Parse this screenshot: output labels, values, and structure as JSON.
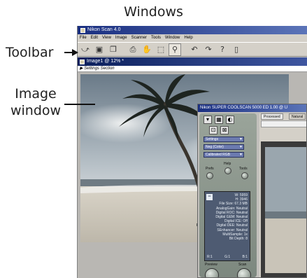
{
  "captions": {
    "windows": "Windows",
    "toolbar": "Toolbar",
    "image_window_line1": "Image",
    "image_window_line2": "window"
  },
  "app": {
    "title": "Nikon Scan 4.0",
    "menu": [
      "File",
      "Edit",
      "View",
      "Image",
      "Scanner",
      "Tools",
      "Window",
      "Help"
    ],
    "toolbar_icons": [
      "open-icon",
      "save-icon",
      "copy-icon",
      "print-icon",
      "hand-icon",
      "crop-icon",
      "zoom-icon",
      "undo-icon",
      "redo-icon",
      "help-icon",
      "scanner-icon"
    ]
  },
  "image_window": {
    "title": "Image1 @ 12% *",
    "settings_label": "Settings Section"
  },
  "scanner_dialog": {
    "title": "Nikon SUPER COOLSCAN 5000 ED 1.00 @ U",
    "dropdowns": [
      "Settings",
      "Neg (Color)",
      "Calibrated RGB"
    ],
    "labels": {
      "prefs": "Prefs",
      "help": "Help",
      "tools": "Tools",
      "preview": "Preview",
      "scan": "Scan"
    },
    "info_lines": [
      "W: 5959",
      "H: 3946",
      "File Size: 67.3 MB",
      "AnalogGain: Neutral",
      "Digital ROC: Neutral",
      "Digital GEM: Neutral",
      "Digital ICE: Off",
      "Digital DEE: Neutral",
      "SEnhancer: Neutral",
      "MultiSample: 1x",
      "Bit Depth: 8"
    ],
    "channels": [
      "R:1",
      "G:1",
      "B:1"
    ],
    "tabs": [
      "Processed",
      "Natural"
    ]
  },
  "colors": {
    "title_bar": "#1a2f80",
    "panel": "#8b958c",
    "dialog_info": "#4e5b72"
  }
}
